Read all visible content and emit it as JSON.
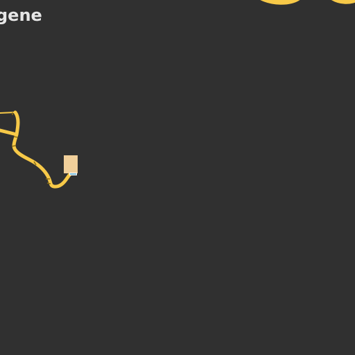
{
  "map": {
    "place_label": "gene",
    "colors": {
      "background": "#303030",
      "road": "#f7c948",
      "road_dark": "#d4a720",
      "marker": "#f0cf9a",
      "marker_accent": "#4aa3c9",
      "label": "#e6e6e6"
    },
    "features": {
      "road": "winding-road",
      "marker": "location-marker"
    }
  }
}
